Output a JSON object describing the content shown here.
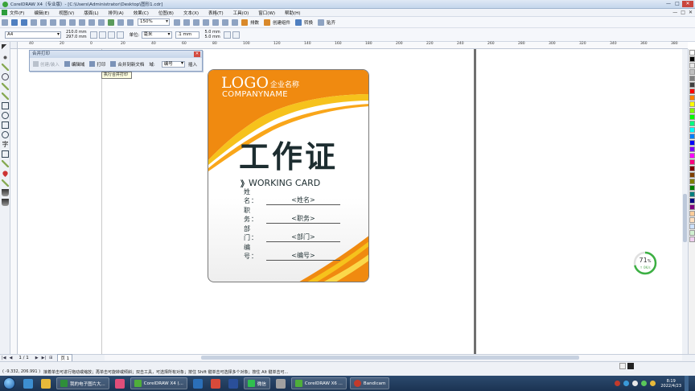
{
  "window": {
    "title": "CorelDRAW X4（专业版）- [C:\\Users\\Administrator\\Desktop\\图形1.cdr]",
    "controls": [
      "—",
      "□",
      "✕"
    ]
  },
  "menu": {
    "items": [
      "文件(F)",
      "编辑(E)",
      "视图(V)",
      "版面(L)",
      "排列(A)",
      "效果(C)",
      "位图(B)",
      "文本(X)",
      "表格(T)",
      "工具(O)",
      "窗口(W)",
      "帮助(H)"
    ],
    "right_controls": [
      "—",
      "□",
      "✕"
    ]
  },
  "toolbar": {
    "zoom": "150%",
    "snap_label": "贴齐",
    "buttons": [
      {
        "label": "排数",
        "icon": "grid-icon"
      },
      {
        "label": "创建组件",
        "icon": "component-icon"
      },
      {
        "label": "转换",
        "icon": "convert-icon"
      }
    ]
  },
  "properties": {
    "page_size": "A4",
    "width": "210.0 mm",
    "height": "297.0 mm",
    "unit_label": "单位:",
    "unit": "毫米",
    "nudge": ".1 mm",
    "dup_x": "5.0 mm",
    "dup_y": "5.0 mm"
  },
  "ruler": {
    "h_ticks": [
      "40",
      "20",
      "0",
      "20",
      "40",
      "60",
      "80",
      "100",
      "120",
      "140",
      "160",
      "180",
      "200",
      "220",
      "240",
      "260",
      "280",
      "300",
      "320",
      "340",
      "360",
      "380"
    ],
    "unit": "毫米"
  },
  "docker": {
    "title": "合并打印",
    "buttons": [
      {
        "label": "创建/装入",
        "enabled": false
      },
      {
        "label": "编辑域",
        "enabled": true
      },
      {
        "label": "打印",
        "enabled": true
      },
      {
        "label": "合并到新文档",
        "enabled": true
      }
    ],
    "field_label": "域:",
    "field_value": "编号",
    "insert_label": "插入",
    "tooltip": "执行合并打印"
  },
  "card": {
    "logo": "LOGO",
    "company_cn": "企业名称",
    "company_en": "COMPANYNAME",
    "title": "工作证",
    "subtitle_mark": "》",
    "subtitle": "WORKING CARD",
    "fields": [
      {
        "label": "姓 名：",
        "value": "<姓名>"
      },
      {
        "label": "职 务：",
        "value": "<职务>"
      },
      {
        "label": "部 门：",
        "value": "<部门>"
      },
      {
        "label": "编 号：",
        "value": "<编号>"
      }
    ],
    "colors": {
      "orange": "#f08a10",
      "yellow": "#f6c21c",
      "dark_text": "#1d2d30"
    }
  },
  "progress": {
    "value": "71",
    "unit": "%",
    "rate": "↑ 0K/s",
    "fraction": 0.71
  },
  "pagenav": {
    "count": "1 / 1",
    "tab": "页 1"
  },
  "status": {
    "coords": "( -9.332, 206.991 )",
    "hint": "接着单击可进行拖动或缩放；再单击可旋转或倾斜；双击工具，可选择所有对象；按住 Shift 键单击可选择多个对象；按住 Alt 键单击可..."
  },
  "taskbar": {
    "items": [
      {
        "label": "我的电子图片大...",
        "color": "#2f8f3a"
      },
      {
        "label": "CorelDRAW X4 (...",
        "color": "#4fae3a"
      },
      {
        "label": "微信",
        "color": "#2fbf4f"
      },
      {
        "label": "CorelDRAW X6 ...",
        "color": "#4fae3a"
      },
      {
        "label": "Bandicam",
        "color": "#c23a2b"
      }
    ],
    "time": "8:19",
    "date": "2022/4/23"
  },
  "palette_colors": [
    "#ffffff",
    "#000000",
    "#e6e6e6",
    "#c0c0c0",
    "#808080",
    "#404040",
    "#ff0000",
    "#ff8000",
    "#ffff00",
    "#80ff00",
    "#00ff00",
    "#00ff80",
    "#00ffff",
    "#0080ff",
    "#0000ff",
    "#8000ff",
    "#ff00ff",
    "#ff0080",
    "#800000",
    "#804000",
    "#808000",
    "#008000",
    "#008080",
    "#000080",
    "#800080",
    "#ffcc99",
    "#ffe0c0",
    "#cce0ff",
    "#d0f0d0",
    "#f0d0f0"
  ]
}
